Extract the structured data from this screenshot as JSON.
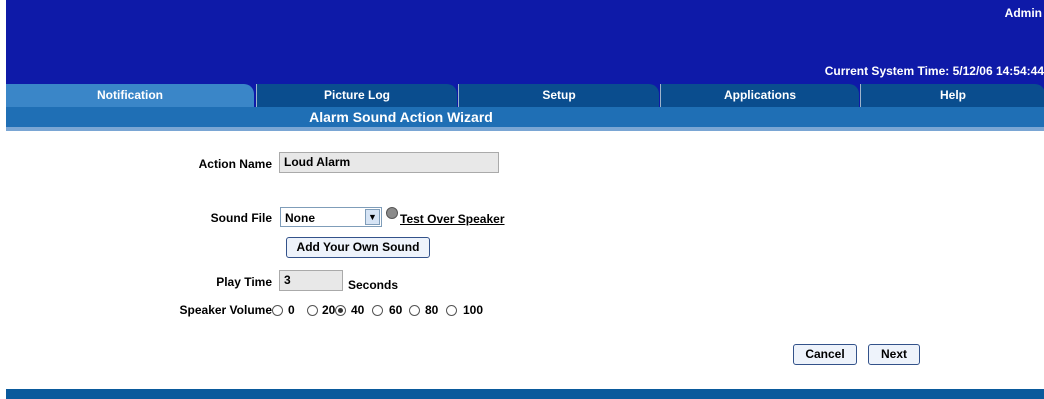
{
  "header": {
    "user": "Admin",
    "system_time": "Current System Time: 5/12/06 14:54:44"
  },
  "tabs": [
    {
      "label": "Notification",
      "active": true
    },
    {
      "label": "Picture Log",
      "active": false
    },
    {
      "label": "Setup",
      "active": false
    },
    {
      "label": "Applications",
      "active": false
    },
    {
      "label": "Help",
      "active": false
    }
  ],
  "wizard": {
    "title": "Alarm Sound Action Wizard"
  },
  "form": {
    "action_name_label": "Action Name",
    "action_name_value": "Loud Alarm",
    "sound_file_label": "Sound File",
    "sound_file_value": "None",
    "test_link": "Test Over Speaker",
    "add_sound_button": "Add Your Own Sound",
    "play_time_label": "Play Time",
    "play_time_value": "3",
    "play_time_unit": "Seconds",
    "volume_label": "Speaker Volume",
    "volume_options": [
      "0",
      "20",
      "40",
      "60",
      "80",
      "100"
    ],
    "volume_selected": "40"
  },
  "buttons": {
    "cancel": "Cancel",
    "next": "Next"
  },
  "colors": {
    "header": "#0e1aa8",
    "tab": "#0a4d8e",
    "tab_active": "#3a86c8",
    "wizard_bar": "#1f6fb5"
  }
}
